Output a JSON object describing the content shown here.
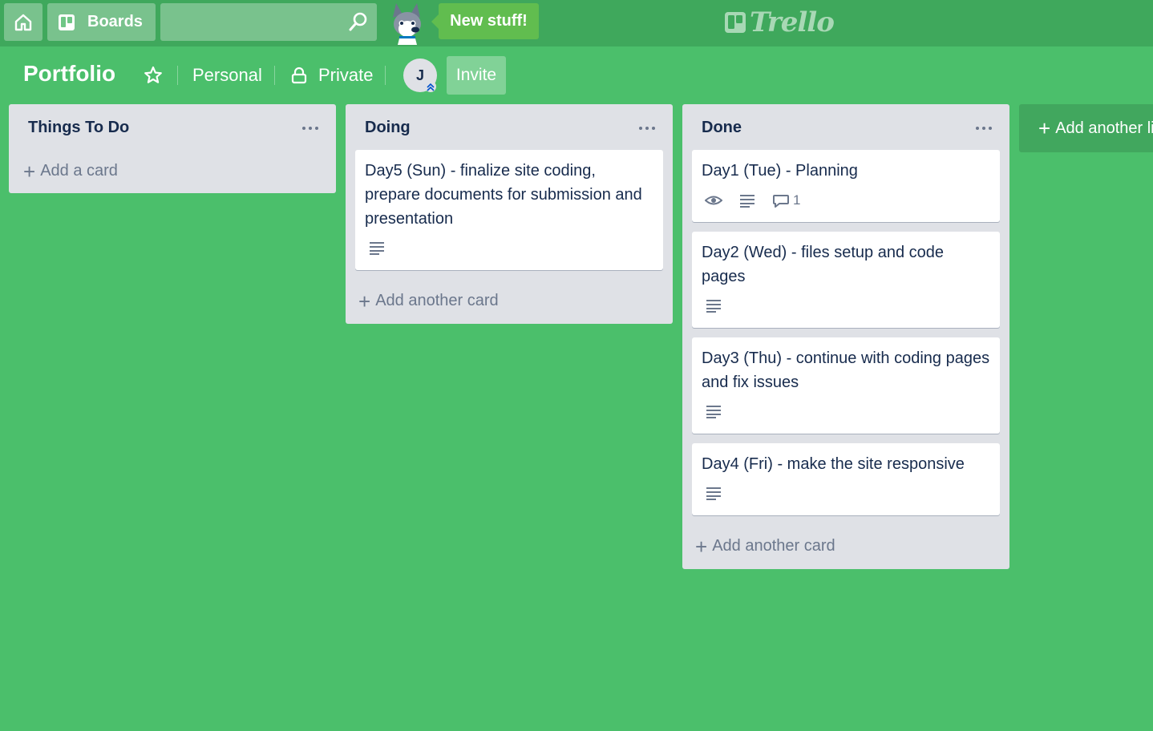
{
  "topbar": {
    "boards_label": "Boards",
    "search_value": "",
    "new_stuff_label": "New stuff!",
    "logo_text": "Trello"
  },
  "board": {
    "title": "Portfolio",
    "team": "Personal",
    "visibility": "Private",
    "member_initial": "J",
    "invite_label": "Invite"
  },
  "lists": [
    {
      "title": "Things To Do",
      "cards": [],
      "add_card_label": "Add a card"
    },
    {
      "title": "Doing",
      "cards": [
        {
          "title": "Day5 (Sun) - finalize site coding, prepare documents for submission and presentation",
          "has_description": true
        }
      ],
      "add_card_label": "Add another card"
    },
    {
      "title": "Done",
      "cards": [
        {
          "title": "Day1 (Tue) - Planning",
          "has_watch": true,
          "has_description": true,
          "comments": "1"
        },
        {
          "title": "Day2 (Wed) - files setup and code pages",
          "has_description": true
        },
        {
          "title": "Day3 (Thu) - continue with coding pages and fix issues",
          "has_description": true
        },
        {
          "title": "Day4 (Fri) - make the site responsive",
          "has_description": true
        }
      ],
      "add_card_label": "Add another card"
    }
  ],
  "add_list_label": "Add another list",
  "colors": {
    "board_background": "#4bbf6b",
    "topbar": "#3fa85c",
    "list_background": "#dfe1e6",
    "new_stuff": "#61bd4f",
    "text_dark": "#172b4d",
    "text_muted": "#6b778c"
  }
}
